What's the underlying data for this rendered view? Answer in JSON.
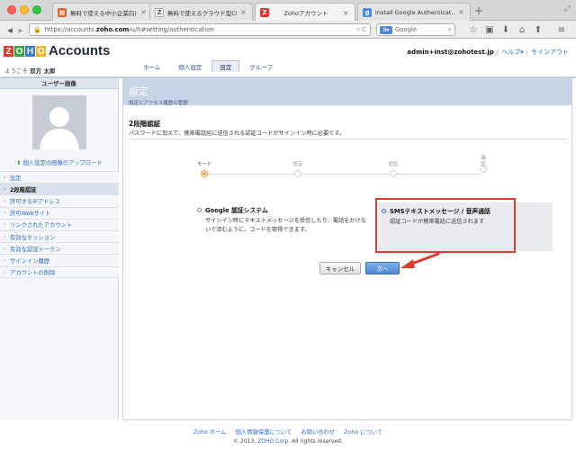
{
  "browser": {
    "tabs": [
      {
        "label": "無料で使える中小企業向け…",
        "favicon": "ms-icon",
        "color": "#e3632a"
      },
      {
        "label": "無料で使えるクラウド型CR…",
        "favicon": "z-page-icon",
        "color": "#9aa3ad"
      },
      {
        "label": "Zohoアカウント",
        "favicon": "zoho-z-icon",
        "color": "#e0332a"
      },
      {
        "label": "Install Google Authenticat…",
        "favicon": "google-icon",
        "color": "#4a88e0"
      }
    ],
    "url_prefix": "https://accounts.",
    "url_domain": "zoho.com",
    "url_suffix": "/u/h#setting/authentication",
    "search_placeholder": "Google"
  },
  "header": {
    "logo_letters": [
      "Z",
      "O",
      "H",
      "O"
    ],
    "logo_colors": [
      "#e03b2f",
      "#36a93f",
      "#3c79c9",
      "#f1b52a"
    ],
    "app_title": "Accounts",
    "welcome_prefix": "ようこそ",
    "welcome_name": "双方 太郎",
    "user_email": "admin+inst@zohotest.jp",
    "help_label": "ヘルプ▾",
    "signout_label": "サインアウト",
    "separator": "|",
    "tabs": [
      "ホーム",
      "個人設定",
      "設定",
      "グループ"
    ],
    "active_tab": 2
  },
  "sidebar": {
    "photo_header": "ユーザー画像",
    "upload_label": "個人設定の画像のアップロード",
    "items": [
      {
        "label": "設定",
        "active": false
      },
      {
        "label": "2段階認証",
        "active": true
      },
      {
        "label": "許可するIPアドレス",
        "active": false
      },
      {
        "label": "許可Webサイト",
        "active": false
      },
      {
        "label": "リンクされたアカウント",
        "active": false
      },
      {
        "label": "有効なセッション",
        "active": false
      },
      {
        "label": "有効な認証トークン",
        "active": false
      },
      {
        "label": "サインイン履歴",
        "active": false
      },
      {
        "label": "アカウントの削除",
        "active": false
      }
    ]
  },
  "main": {
    "title": "設定",
    "subtitle": "設定とアクセス履歴の管理",
    "section_title": "2段階認証",
    "section_desc": "パスワードに加えて、携帯電話宛に送信される認証コードがサインイン時に必要です。",
    "steps": [
      "モード",
      "設定",
      "認証",
      "確\n認"
    ],
    "current_step": 0,
    "option_google": {
      "title": "Google 認証システム",
      "desc": "サインイン時にテキストメッセージを受信したり、電話をかけないで済むように、コードを取得できます。",
      "selected": false
    },
    "option_sms": {
      "title": "SMSテキストメッセージ / 音声通話",
      "desc": "認証コードが携帯電話に送信されます",
      "selected": true
    },
    "cancel_label": "キャンセル",
    "next_label": "次へ"
  },
  "footer": {
    "links": [
      "Zoho ホーム",
      "個人情報保護について",
      "お問い合わせ",
      "Zoho について"
    ],
    "copyright_prefix": "© 2013,",
    "copyright_corp": "ZOHO Corp.",
    "copyright_suffix": "All rights reserved."
  },
  "colors": {
    "accent_red": "#e03b2f",
    "link_blue": "#2d6bc8",
    "step_active": "#f0a640"
  }
}
